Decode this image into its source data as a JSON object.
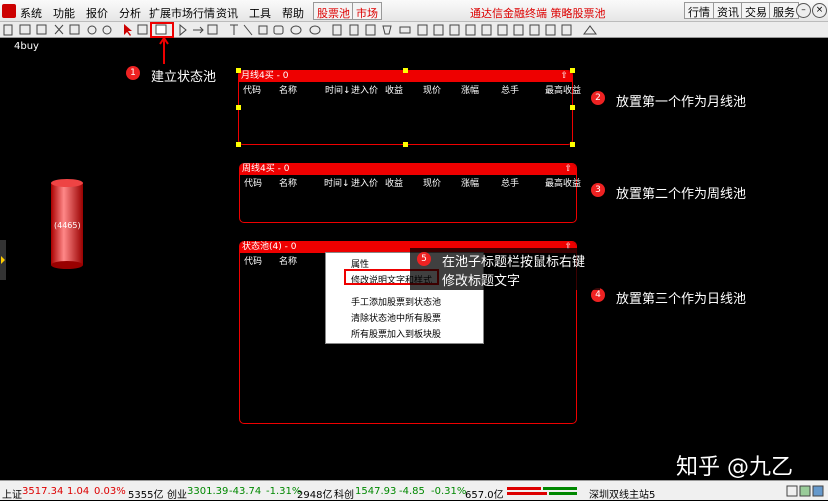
{
  "menu": {
    "items": [
      "系统",
      "功能",
      "报价",
      "分析",
      "扩展市场行情",
      "资讯",
      "工具",
      "帮助"
    ],
    "tabs": [
      "股票池",
      "市场"
    ],
    "title": "通达信金融终端 策略股票池",
    "right_buttons": [
      "行情",
      "资讯",
      "交易",
      "服务"
    ]
  },
  "canvas": {
    "label": "4buy",
    "cylinder_label": "(4465)"
  },
  "pools": [
    {
      "title": "月线4买 - 0",
      "columns": [
        "代码",
        "名称",
        "时间↓",
        "进入价",
        "收益",
        "现价",
        "涨幅",
        "总手",
        "最高收益"
      ]
    },
    {
      "title": "周线4买 - 0",
      "columns": [
        "代码",
        "名称",
        "时间↓",
        "进入价",
        "收益",
        "现价",
        "涨幅",
        "总手",
        "最高收益"
      ]
    },
    {
      "title": "状态池(4) - 0",
      "columns": [
        "代码",
        "名称"
      ]
    }
  ],
  "annotations": [
    {
      "num": "1",
      "text": "建立状态池"
    },
    {
      "num": "2",
      "text": "放置第一个作为月线池"
    },
    {
      "num": "3",
      "text": "放置第二个作为周线池"
    },
    {
      "num": "4",
      "text": "放置第三个作为日线池"
    },
    {
      "num": "5",
      "text": "在池子标题栏按鼠标右键",
      "text2": "修改标题文字"
    }
  ],
  "context_menu": [
    "属性",
    "修改说明文字和样式",
    "手工添加股票到状态池",
    "清除状态池中所有股票",
    "所有股票加入到板块股"
  ],
  "status": {
    "sh_label": "上证",
    "sh_value": "3517.34",
    "sh_change": "1.04",
    "sh_pct": "0.03%",
    "sh_amount": "5355亿",
    "cy_label": "创业",
    "cy_value": "3301.39",
    "cy_change": "-43.74",
    "cy_pct": "-1.31%",
    "cy_amount": "2948亿",
    "kc_label": "科创",
    "kc_value": "1547.93",
    "kc_change": "-4.85",
    "kc_pct": "-0.31%",
    "kc_amount": "657.0亿",
    "server": "深圳双线主站5"
  },
  "watermark": "知乎 @九乙",
  "colors": {
    "accent": "#e00000",
    "up": "#d00000",
    "down": "#008000"
  }
}
